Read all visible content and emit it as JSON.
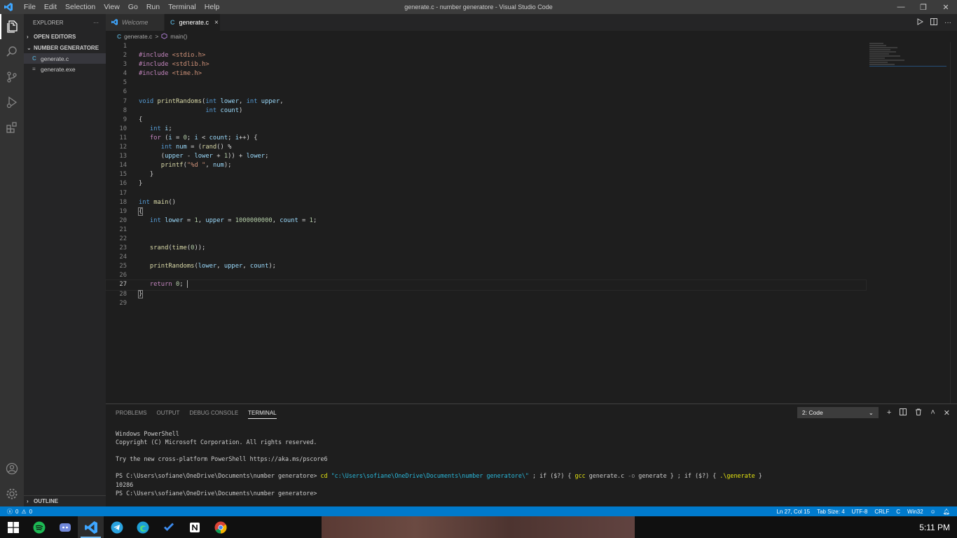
{
  "window": {
    "title": "generate.c - number generatore - Visual Studio Code",
    "menu": [
      "File",
      "Edit",
      "Selection",
      "View",
      "Go",
      "Run",
      "Terminal",
      "Help"
    ]
  },
  "sidebar": {
    "header": "EXPLORER",
    "more": "···",
    "open_editors": "OPEN EDITORS",
    "folder": "NUMBER GENERATORE",
    "files": [
      {
        "name": "generate.c",
        "icon": "C"
      },
      {
        "name": "generate.exe",
        "icon": "≡"
      }
    ],
    "outline": "OUTLINE"
  },
  "editor": {
    "tabs": [
      {
        "label": "Welcome"
      },
      {
        "label": "generate.c",
        "icon": "C",
        "close": "×"
      }
    ],
    "breadcrumb": {
      "file": "generate.c",
      "separator": ">",
      "symbol": "main()",
      "file_icon": "C"
    },
    "line_numbers": [
      "1",
      "2",
      "3",
      "4",
      "5",
      "6",
      "7",
      "8",
      "9",
      "10",
      "11",
      "12",
      "13",
      "14",
      "15",
      "16",
      "17",
      "18",
      "19",
      "20",
      "21",
      "22",
      "23",
      "24",
      "25",
      "26",
      "27",
      "28",
      "29"
    ],
    "code": {
      "l2_pp": "#include",
      "l2_inc": "<stdio.h>",
      "l3_pp": "#include",
      "l3_inc": "<stdlib.h>",
      "l4_pp": "#include",
      "l4_inc": "<time.h>",
      "l7_void": "void",
      "l7_fn": "printRandoms",
      "l7_p1": "(",
      "l7_int1": "int",
      "l7_lower": "lower",
      "l7_c": ", ",
      "l7_int2": "int",
      "l7_upper": "upper",
      "l7_end": ",",
      "l8_int": "int",
      "l8_count": "count",
      "l8_end": ")",
      "l9": "{",
      "l10_int": "int",
      "l10_i": "i",
      "l10_end": ";",
      "l11_for": "for",
      "l11_a": " (",
      "l11_i": "i",
      "l11_b": " = ",
      "l11_0": "0",
      "l11_c": "; ",
      "l11_i2": "i",
      "l11_d": " < ",
      "l11_count": "count",
      "l11_e": "; ",
      "l11_i3": "i",
      "l11_f": "++) {",
      "l12_int": "int",
      "l12_num": "num",
      "l12_a": " = (",
      "l12_rand": "rand",
      "l12_b": "() %",
      "l13_a": "(",
      "l13_upper": "upper",
      "l13_b": " - ",
      "l13_lower": "lower",
      "l13_c": " + ",
      "l13_1": "1",
      "l13_d": ")) + ",
      "l13_lower2": "lower",
      "l13_e": ";",
      "l14_printf": "printf",
      "l14_a": "(",
      "l14_str": "\"%d \"",
      "l14_b": ", ",
      "l14_num": "num",
      "l14_c": ");",
      "l15": "}",
      "l16": "}",
      "l18_int": "int",
      "l18_main": "main",
      "l18_a": "()",
      "l19": "{",
      "l20_int": "int",
      "l20_lower": "lower",
      "l20_a": " = ",
      "l20_1": "1",
      "l20_b": ", ",
      "l20_upper": "upper",
      "l20_c": " = ",
      "l20_big": "1000000000",
      "l20_d": ", ",
      "l20_count": "count",
      "l20_e": " = ",
      "l20_1b": "1",
      "l20_f": ";",
      "l23_srand": "srand",
      "l23_a": "(",
      "l23_time": "time",
      "l23_b": "(",
      "l23_0": "0",
      "l23_c": "));",
      "l25_fn": "printRandoms",
      "l25_a": "(",
      "l25_lower": "lower",
      "l25_b": ", ",
      "l25_upper": "upper",
      "l25_c": ", ",
      "l25_count": "count",
      "l25_d": ");",
      "l27_return": "return",
      "l27_sp": " ",
      "l27_0": "0",
      "l27_end": "; ",
      "l28": "}"
    }
  },
  "panel": {
    "tabs": [
      "PROBLEMS",
      "OUTPUT",
      "DEBUG CONSOLE",
      "TERMINAL"
    ],
    "terminal_select": "2: Code",
    "terminal": {
      "l1": "Windows PowerShell",
      "l2": "Copyright (C) Microsoft Corporation. All rights reserved.",
      "l4": "Try the new cross-platform PowerShell https://aka.ms/pscore6",
      "l6_prompt": "PS C:\\Users\\sofiane\\OneDrive\\Documents\\number generatore> ",
      "l6_cd": "cd",
      "l6_path": " \"c:\\Users\\sofiane\\OneDrive\\Documents\\number generatore\\\"",
      "l6_a": " ; if ($?) { ",
      "l6_gcc": "gcc",
      "l6_b": " generate.c ",
      "l6_o": "-o",
      "l6_c": " generate } ; if ($?) { ",
      "l6_run": ".\\generate",
      "l6_d": " }",
      "l7": "10286",
      "l8": "PS C:\\Users\\sofiane\\OneDrive\\Documents\\number generatore>"
    }
  },
  "statusbar": {
    "errors": "0",
    "warnings": "0",
    "position": "Ln 27, Col 15",
    "tab_size": "Tab Size: 4",
    "encoding": "UTF-8",
    "eol": "CRLF",
    "language": "C",
    "platform": "Win32"
  },
  "taskbar": {
    "time": "5:11 PM",
    "apps": [
      "windows-start-icon",
      "spotify-icon",
      "discord-icon",
      "vscode-icon",
      "telegram-icon",
      "edge-icon",
      "todo-icon",
      "notion-icon",
      "chrome-icon"
    ]
  },
  "colors": {
    "accent": "#007acc",
    "titlebar": "#3c3c3c",
    "sidebar": "#252526",
    "editor_bg": "#1e1e1e"
  }
}
